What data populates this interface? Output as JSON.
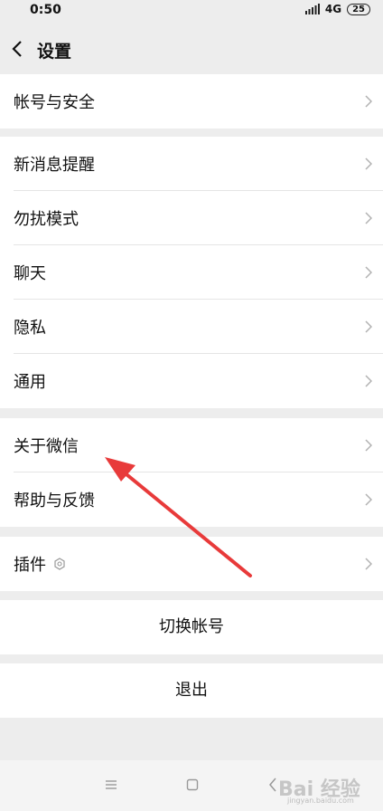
{
  "status": {
    "time": "0:50",
    "network": "4G",
    "battery": "25"
  },
  "nav": {
    "title": "设置"
  },
  "groups": {
    "account": [
      "帐号与安全"
    ],
    "notifications": [
      "新消息提醒",
      "勿扰模式",
      "聊天",
      "隐私",
      "通用"
    ],
    "about": [
      "关于微信",
      "帮助与反馈"
    ],
    "plugins": [
      "插件"
    ]
  },
  "actions": {
    "switch_account": "切换帐号",
    "logout": "退出"
  },
  "watermark": {
    "brand": "Bai 经验",
    "url": "jingyan.baidu.com"
  },
  "colors": {
    "annotation_arrow": "#e83a3a",
    "background": "#ededed"
  }
}
